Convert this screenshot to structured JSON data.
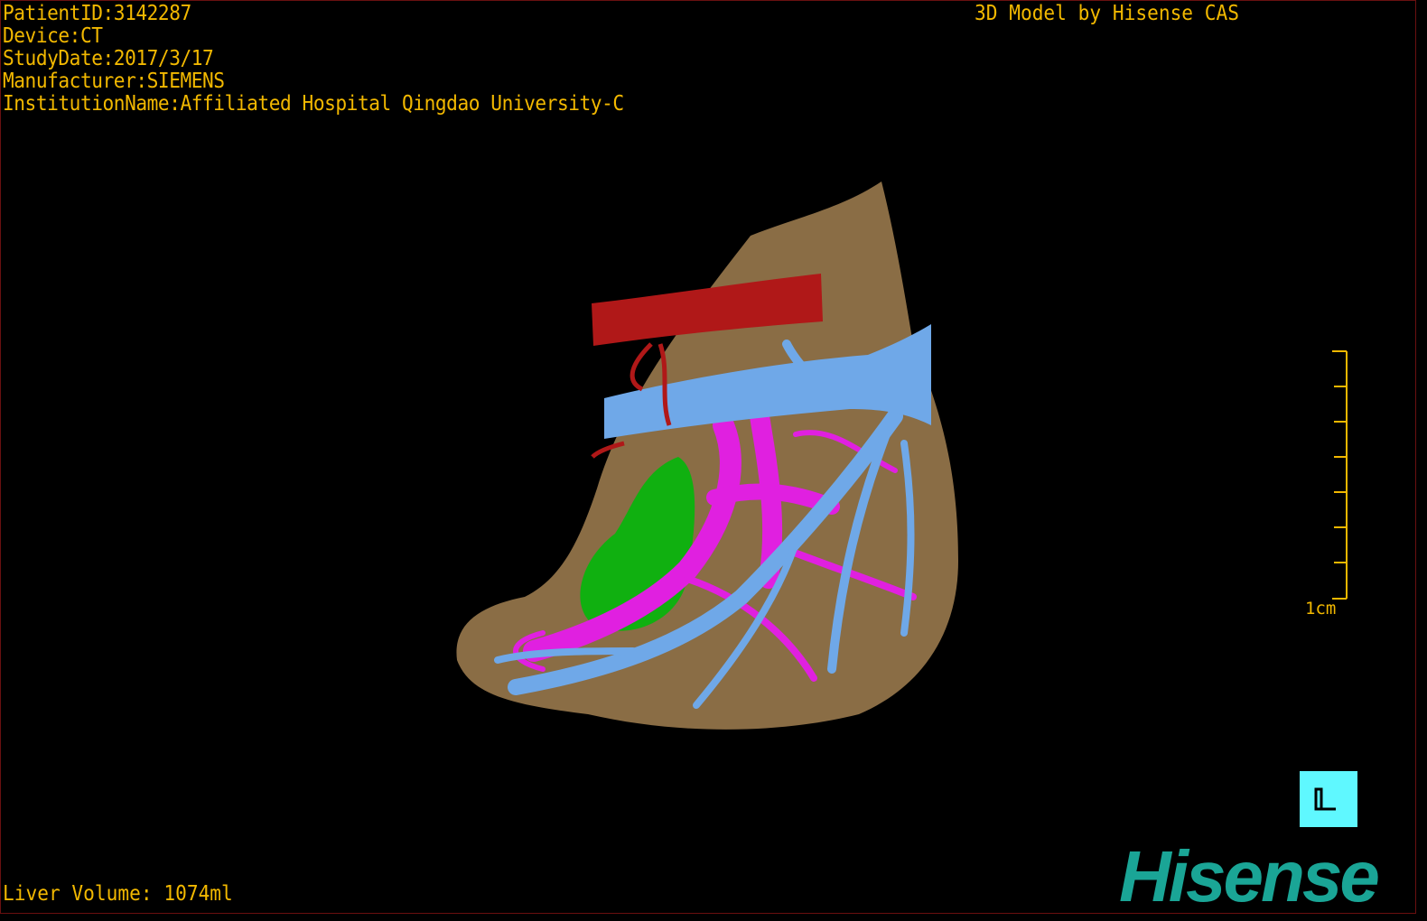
{
  "patient_info": {
    "patient_id": "PatientID:3142287",
    "device": "Device:CT",
    "study_date": "StudyDate:2017/3/17",
    "manufacturer": "Manufacturer:SIEMENS",
    "institution": "InstitutionName:Affiliated Hospital Qingdao University-C"
  },
  "credit": "3D Model by Hisense CAS",
  "liver_volume": "Liver Volume: 1074ml",
  "scale_bar": {
    "label": "1cm"
  },
  "orientation_marker": {
    "icon": "orientation-cube-icon",
    "color": "#5ff8ff"
  },
  "logo": {
    "text": "Hisense",
    "color": "#1aa596"
  },
  "colors": {
    "text": "#f2b800",
    "liver": "#8a6d45",
    "artery": "#b01818",
    "portal_vein": "#e020e0",
    "hepatic_vein": "#6fa8e8",
    "gallbladder": "#10b010"
  }
}
